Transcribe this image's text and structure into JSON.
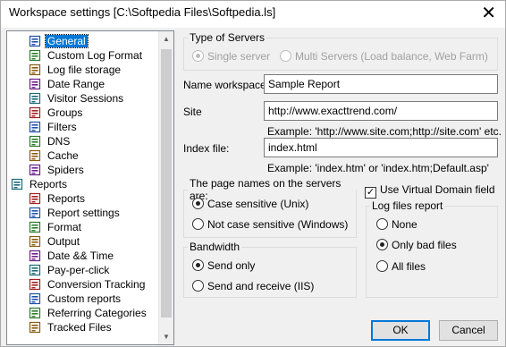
{
  "window": {
    "title": "Workspace settings [C:\\Softpedia Files\\Softpedia.ls]",
    "close": "✕"
  },
  "tree": {
    "items": [
      {
        "label": "General",
        "level": 1,
        "icon": "general-icon",
        "selected": true
      },
      {
        "label": "Custom Log Format",
        "level": 1,
        "icon": "custom-log-format-icon"
      },
      {
        "label": "Log file storage",
        "level": 1,
        "icon": "log-storage-icon"
      },
      {
        "label": "Date Range",
        "level": 1,
        "icon": "date-range-icon"
      },
      {
        "label": "Visitor Sessions",
        "level": 1,
        "icon": "visitor-sessions-icon"
      },
      {
        "label": "Groups",
        "level": 1,
        "icon": "groups-icon"
      },
      {
        "label": "Filters",
        "level": 1,
        "icon": "filters-icon"
      },
      {
        "label": "DNS",
        "level": 1,
        "icon": "dns-icon"
      },
      {
        "label": "Cache",
        "level": 1,
        "icon": "cache-icon"
      },
      {
        "label": "Spiders",
        "level": 1,
        "icon": "spiders-icon"
      },
      {
        "label": "Reports",
        "level": 0,
        "icon": "reports-root-icon"
      },
      {
        "label": "Reports",
        "level": 1,
        "icon": "reports-icon"
      },
      {
        "label": "Report settings",
        "level": 1,
        "icon": "report-settings-icon"
      },
      {
        "label": "Format",
        "level": 1,
        "icon": "format-icon"
      },
      {
        "label": "Output",
        "level": 1,
        "icon": "output-icon"
      },
      {
        "label": "Date && Time",
        "level": 1,
        "icon": "date-time-icon"
      },
      {
        "label": "Pay-per-click",
        "level": 1,
        "icon": "pay-per-click-icon"
      },
      {
        "label": "Conversion Tracking",
        "level": 1,
        "icon": "conversion-tracking-icon"
      },
      {
        "label": "Custom reports",
        "level": 1,
        "icon": "custom-reports-icon"
      },
      {
        "label": "Referring Categories",
        "level": 1,
        "icon": "referring-categories-icon"
      },
      {
        "label": "Tracked Files",
        "level": 1,
        "icon": "tracked-files-icon"
      }
    ]
  },
  "servers": {
    "legend": "Type of Servers",
    "single": "Single server",
    "multi": "Multi Servers (Load balance, Web Farm)"
  },
  "fields": {
    "name_label": "Name workspace:",
    "name_value": "Sample Report",
    "site_label": "Site",
    "site_value": "http://www.exacttrend.com/",
    "site_example": "Example: 'http://www.site.com;http://site.com' etc.",
    "index_label": "Index file:",
    "index_value": "index.html",
    "index_example": "Example: 'index.htm' or 'index.htm;Default.asp'"
  },
  "pagenames": {
    "legend": "The page names on the servers are:",
    "case_sensitive": "Case sensitive (Unix)",
    "not_case_sensitive": "Not case sensitive (Windows)"
  },
  "bandwidth": {
    "legend": "Bandwidth",
    "send_only": "Send only",
    "send_receive": "Send and receive (IIS)"
  },
  "virtual_domain": {
    "label": "Use Virtual Domain field",
    "checked": true
  },
  "log_files": {
    "legend": "Log files report",
    "none": "None",
    "bad_files": "Only bad files",
    "all_files": "All files"
  },
  "buttons": {
    "ok": "OK",
    "cancel": "Cancel"
  },
  "colors": {
    "selection": "#0078d7",
    "window_bg": "#f0f0f0"
  }
}
